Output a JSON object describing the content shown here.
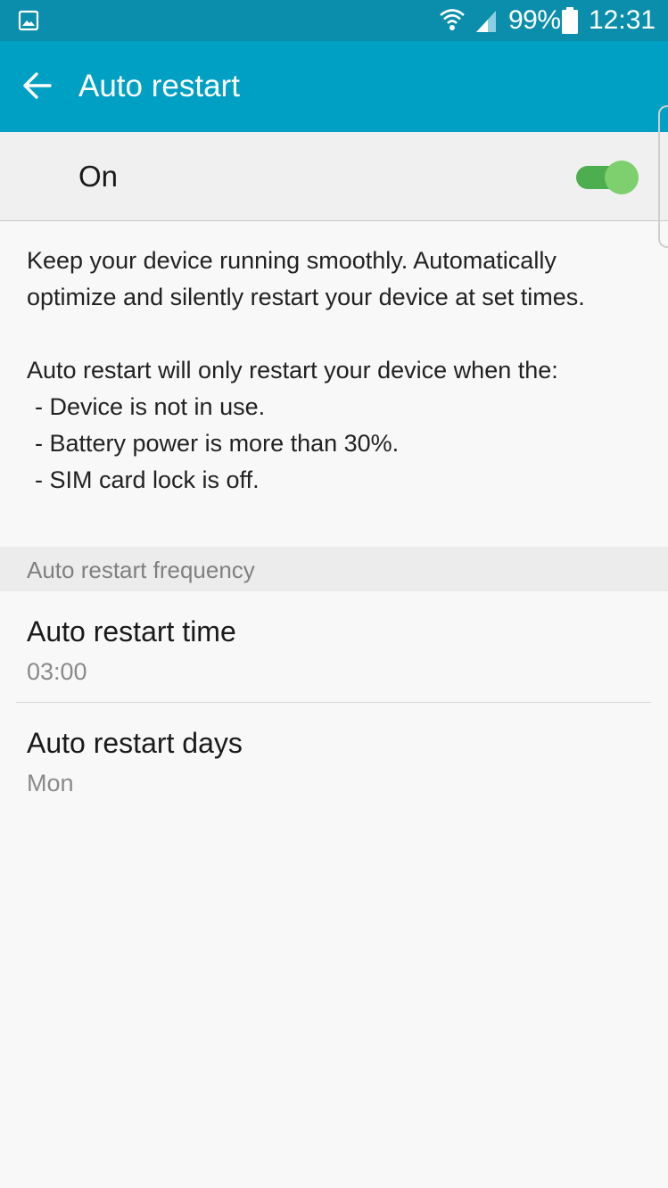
{
  "status_bar": {
    "battery_percent": "99%",
    "time": "12:31",
    "icons": {
      "left": "gallery-icon",
      "wifi": "wifi-icon",
      "signal": "signal-icon",
      "battery": "battery-icon"
    }
  },
  "app_bar": {
    "title": "Auto restart",
    "back_icon": "arrow-left-icon"
  },
  "master_switch": {
    "label": "On",
    "state": true
  },
  "description": {
    "intro": "Keep your device running smoothly. Automatically optimize and silently restart your device at set times.",
    "condition_heading": "Auto restart will only restart your device when the:",
    "conditions": [
      "- Device is not in use.",
      "- Battery power is more than 30%.",
      "- SIM card lock is off."
    ]
  },
  "section": {
    "header": "Auto restart frequency"
  },
  "settings": [
    {
      "title": "Auto restart time",
      "value": "03:00"
    },
    {
      "title": "Auto restart days",
      "value": "Mon"
    }
  ],
  "colors": {
    "status_bar": "#0a8eac",
    "app_bar": "#00a0c4",
    "switch_track": "#4cae4f",
    "switch_thumb": "#7dd06d",
    "background": "#f8f8f8"
  }
}
